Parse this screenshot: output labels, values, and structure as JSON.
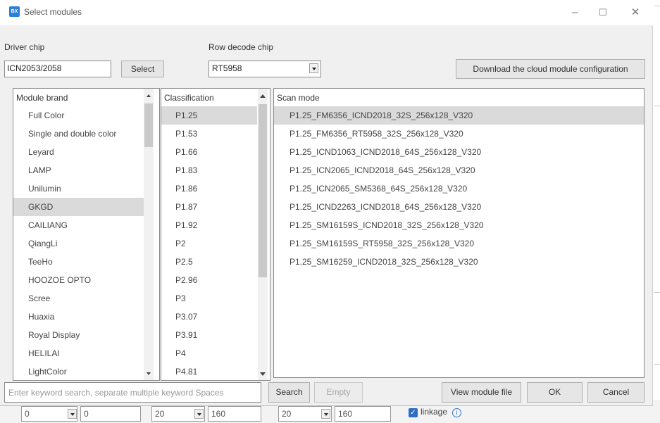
{
  "window": {
    "title": "Select modules",
    "icon_text": "BX"
  },
  "driver_chip": {
    "label": "Driver chip",
    "value": "ICN2053/2058",
    "select_label": "Select"
  },
  "row_decode": {
    "label": "Row decode chip",
    "value": "RT5958"
  },
  "download_label": "Download the cloud module configuration",
  "brand": {
    "header": "Module brand",
    "items": [
      "Full Color",
      "Single and double color",
      "Leyard",
      "LAMP",
      "Unilumin",
      "GKGD",
      "CAILIANG",
      "QiangLi",
      "TeeHo",
      "HOOZOE OPTO",
      "Scree",
      "Huaxia",
      "Royal Display",
      "HELILAI",
      "LightColor"
    ],
    "selected_index": 5
  },
  "classification": {
    "header": "Classification",
    "items": [
      "P1.25",
      "P1.53",
      "P1.66",
      "P1.83",
      "P1.86",
      "P1.87",
      "P1.92",
      "P2",
      "P2.5",
      "P2.96",
      "P3",
      "P3.07",
      "P3.91",
      "P4",
      "P4.81"
    ],
    "selected_index": 0
  },
  "scan": {
    "header": "Scan mode",
    "items": [
      "P1.25_FM6356_ICND2018_32S_256x128_V320",
      "P1.25_FM6356_RT5958_32S_256x128_V320",
      "P1.25_ICND1063_ICND2018_64S_256x128_V320",
      "P1.25_ICN2065_ICND2018_64S_256x128_V320",
      "P1.25_ICN2065_SM5368_64S_256x128_V320",
      "P1.25_ICND2263_ICND2018_64S_256x128_V320",
      "P1.25_SM16159S_ICND2018_32S_256x128_V320",
      "P1.25_SM16159S_RT5958_32S_256x128_V320",
      "P1.25_SM16259_ICND2018_32S_256x128_V320"
    ],
    "selected_index": 0
  },
  "bottom": {
    "search_placeholder": "Enter keyword search, separate multiple keyword Spaces",
    "search_label": "Search",
    "empty_label": "Empty",
    "view_label": "View module file",
    "ok_label": "OK",
    "cancel_label": "Cancel"
  },
  "background": {
    "field1": "0",
    "field2": "0",
    "field3": "20",
    "field4": "160",
    "field5": "20",
    "field6": "160",
    "linkage_label": "linkage"
  }
}
